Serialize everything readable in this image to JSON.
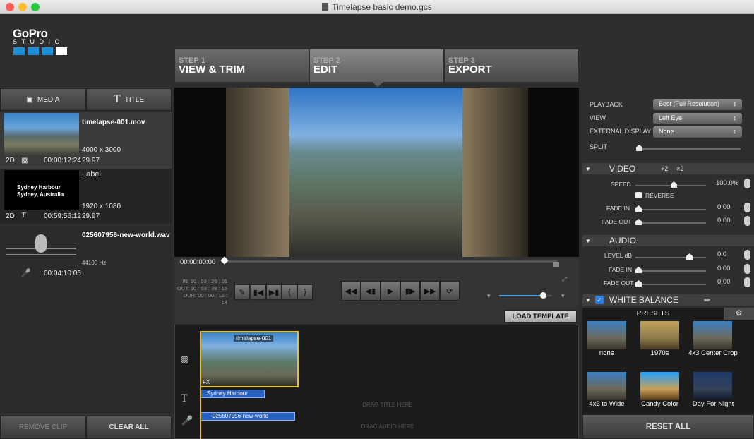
{
  "window": {
    "title": "Timelapse basic demo.gcs"
  },
  "logo": {
    "brand": "GoPro",
    "sub": "STUDIO"
  },
  "steps": [
    {
      "num": "STEP 1",
      "label": "VIEW & TRIM"
    },
    {
      "num": "STEP 2",
      "label": "EDIT"
    },
    {
      "num": "STEP 3",
      "label": "EXPORT"
    }
  ],
  "library": {
    "tabs": {
      "media": "MEDIA",
      "title": "TITLE"
    },
    "clips": [
      {
        "name": "timelapse-001.mov",
        "res": "4000 x 3000",
        "mode": "2D",
        "dur": "00:00:12:24",
        "fps": "29.97"
      },
      {
        "name": "Label",
        "thumb_l1": "Sydney Harbour",
        "thumb_l2": "Sydney, Australia",
        "res": "1920 x 1080",
        "mode": "2D",
        "dur": "00:59:56:12",
        "fps": "29.97"
      },
      {
        "name": "025607956-new-world.wav",
        "rate": "44100 Hz",
        "dur": "00:04:10:05"
      }
    ],
    "remove": "REMOVE CLIP",
    "clear": "CLEAR ALL"
  },
  "player": {
    "timecode": "00:00:00:00",
    "in": "IN: 10 : 03 : 26 : 01",
    "out": "OUT: 10 : 03 : 38 : 15",
    "dur": "DUR: 00 : 00 : 12 : 14",
    "volume": 0.83
  },
  "load_template": "LOAD TEMPLATE",
  "timeline": {
    "video_clip": "timelapse-001",
    "fx": "FX",
    "title_clip": "Sydney Harbour",
    "drag_title": "DRAG TITLE HERE",
    "audio_clip": "025607956-new-world",
    "drag_audio": "DRAG AUDIO HERE"
  },
  "settings": {
    "playback_label": "PLAYBACK",
    "playback": "Best (Full Resolution)",
    "view_label": "VIEW",
    "view": "Left Eye",
    "ext_label": "EXTERNAL DISPLAY",
    "ext": "None",
    "split_label": "SPLIT",
    "video": {
      "title": "VIDEO",
      "div2": "÷2",
      "mul2": "×2",
      "speed_label": "SPEED",
      "speed": "100.0%",
      "reverse": "REVERSE",
      "fadein_label": "FADE IN",
      "fadein": "0.00",
      "fadeout_label": "FADE OUT",
      "fadeout": "0.00"
    },
    "audio": {
      "title": "AUDIO",
      "level_label": "LEVEL dB",
      "level": "0.0",
      "fadein_label": "FADE IN",
      "fadein": "0.00",
      "fadeout_label": "FADE OUT",
      "fadeout": "0.00"
    },
    "wb": {
      "title": "WHITE BALANCE"
    },
    "presets_tab": "PRESETS",
    "presets": [
      "none",
      "1970s",
      "4x3 Center Crop",
      "4x3 to Wide",
      "Candy Color",
      "Day For Night"
    ],
    "reset": "RESET ALL"
  }
}
